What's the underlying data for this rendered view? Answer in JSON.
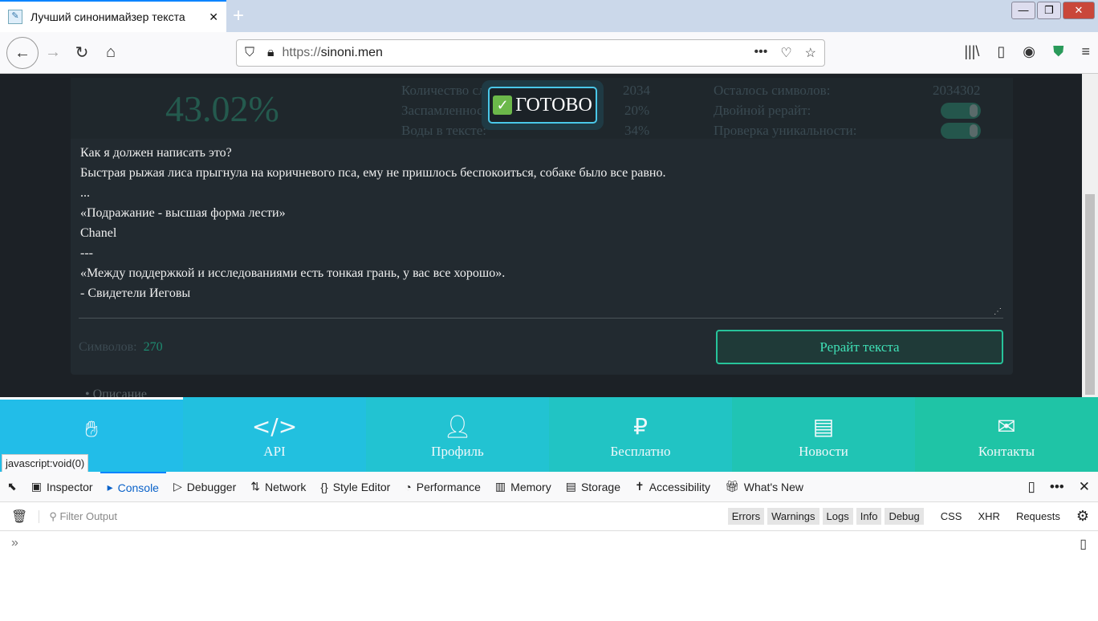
{
  "browser": {
    "tab_title": "Лучший синонимайзер текста",
    "url_scheme": "https://",
    "url_host": "sinoni.men",
    "status_url": "javascript:void(0)"
  },
  "stats": {
    "percent": "43.02%",
    "rows": [
      {
        "label": "Количество слов:",
        "value": "2034"
      },
      {
        "label": "Заспамленность:",
        "value": "20%"
      },
      {
        "label": "Воды в тексте:",
        "value": "34%"
      }
    ],
    "right": [
      {
        "label": "Осталось символов:",
        "value": "2034302"
      },
      {
        "label": "Двойной рерайт:",
        "toggle": "on"
      },
      {
        "label": "Проверка уникальности:",
        "toggle": "on"
      }
    ]
  },
  "ready_badge": "ГОТОВО",
  "text_lines": [
    "Как я должен написать это?",
    "Быстрая рыжая лиса прыгнула на коричневого пса, ему не пришлось беспокоиться, собаке было все равно.",
    "...",
    "«Подражание - высшая форма лести»",
    "Chanel",
    "---",
    "«Между поддержкой и исследованиями есть тонкая грань, у вас все хорошо».",
    "- Свидетели Иеговы"
  ],
  "chars_label": "Символов:",
  "chars_value": "270",
  "rewrite_button": "Рерайт текста",
  "description": "Описание",
  "footer": [
    {
      "label": "",
      "icon": "hand-icon",
      "color": "#22bde8"
    },
    {
      "label": "API",
      "icon": "code-icon",
      "color": "#22c0df"
    },
    {
      "label": "Профиль",
      "icon": "user-icon",
      "color": "#22c3d2"
    },
    {
      "label": "Бесплатно",
      "icon": "ruble-icon",
      "color": "#21c4c4"
    },
    {
      "label": "Новости",
      "icon": "newspaper-icon",
      "color": "#20c4b4"
    },
    {
      "label": "Контакты",
      "icon": "envelope-icon",
      "color": "#1fc4a6"
    }
  ],
  "devtools": {
    "tabs": [
      "Inspector",
      "Console",
      "Debugger",
      "Network",
      "Style Editor",
      "Performance",
      "Memory",
      "Storage",
      "Accessibility",
      "What's New"
    ],
    "filter_placeholder": "Filter Output",
    "levels": [
      "Errors",
      "Warnings",
      "Logs",
      "Info",
      "Debug"
    ],
    "extras": [
      "CSS",
      "XHR",
      "Requests"
    ]
  }
}
